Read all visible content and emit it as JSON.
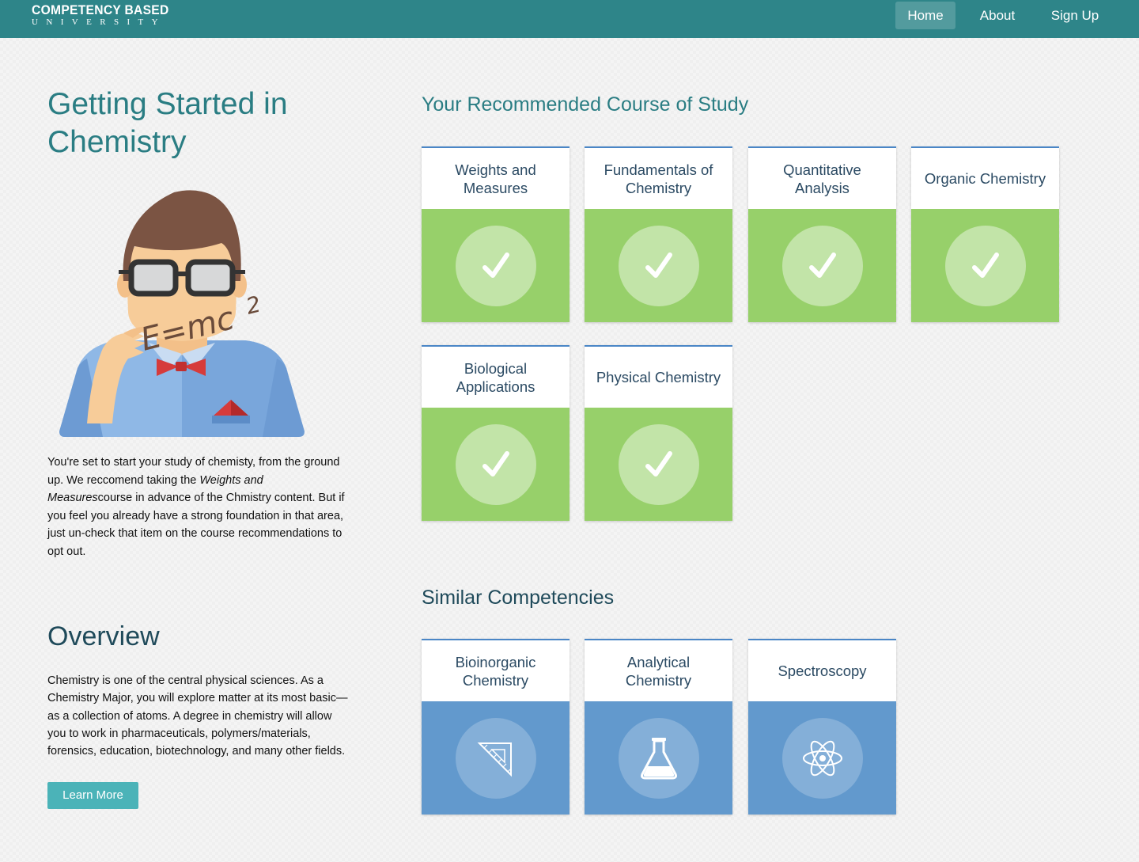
{
  "navbar": {
    "brand_top": "COMPETENCY BASED",
    "brand_bottom": "UNIVERSITY",
    "links": [
      {
        "label": "Home",
        "active": true
      },
      {
        "label": "About"
      },
      {
        "label": "Sign Up"
      }
    ]
  },
  "hero": {
    "title": "Getting Started in Chemistry",
    "illustration_text": "E=mc",
    "illustration_superscript": "2",
    "intro_part1": "You're set to start your study of chemisty, from the ground up. We reccomend taking the ",
    "intro_italic": "Weights and Measures",
    "intro_part2": "course in advance of the Chmistry content. But if you feel you already have a strong foundation in that area, just un-check that item on the course recommendations to opt out."
  },
  "overview": {
    "title": "Overview",
    "text": "Chemistry is one of the central physical sciences. As a Chemistry Major, you will explore matter at its most basic—as a collection of atoms. A degree in chemistry will allow you to work in pharmaceuticals, polymers/materials, forensics, education, biotechnology, and many other fields.",
    "button_label": "Learn More"
  },
  "recommended": {
    "title": "Your Recommended Course of Study",
    "courses": [
      {
        "label": "Weights and Measures",
        "icon": "checkmark-icon",
        "checked": true
      },
      {
        "label": "Fundamentals of Chemistry",
        "icon": "checkmark-icon",
        "checked": true
      },
      {
        "label": "Quantitative Analysis",
        "icon": "checkmark-icon",
        "checked": true
      },
      {
        "label": "Organic Chemistry",
        "icon": "checkmark-icon",
        "checked": true
      },
      {
        "label": "Biological Applications",
        "icon": "checkmark-icon",
        "checked": true
      },
      {
        "label": "Physical Chemistry",
        "icon": "checkmark-icon",
        "checked": true
      }
    ]
  },
  "similar": {
    "title": "Similar Competencies",
    "items": [
      {
        "label": "Bioinorganic Chemistry",
        "icon": "set-square-icon"
      },
      {
        "label": "Analytical Chemistry",
        "icon": "flask-icon"
      },
      {
        "label": "Spectroscopy",
        "icon": "atom-icon"
      }
    ]
  },
  "colors": {
    "navbar": "#2e8589",
    "title_teal": "#2a7d83",
    "card_green": "#97d06a",
    "card_blue": "#6299cd",
    "card_border": "#4a86c6",
    "button": "#4bb3b8"
  }
}
